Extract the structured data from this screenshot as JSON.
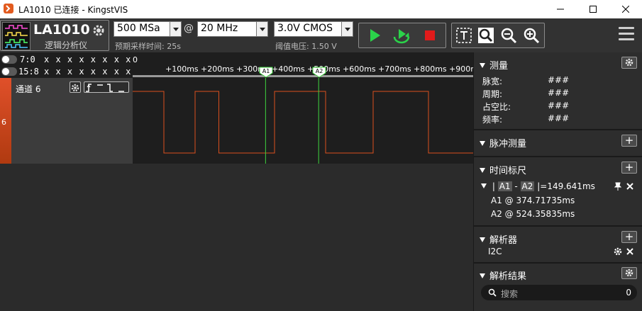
{
  "window": {
    "title": "LA1010 已连接 - KingstVIS"
  },
  "toolbar": {
    "device_name": "LA1010",
    "device_subtitle": "逻辑分析仪",
    "sample_rate": "500 MSa",
    "at_symbol": "@",
    "frequency": "20 MHz",
    "estimated_time": "预期采样时间: 25s",
    "voltage": "3.0V CMOS",
    "threshold": "阈值电压: 1.50 V"
  },
  "bus": {
    "rows": [
      {
        "label": "7:0",
        "value": "x x x x x x x x"
      },
      {
        "label": "15:8",
        "value": "x x x x x x x x"
      }
    ]
  },
  "ruler": {
    "ticks": [
      "0",
      "+100ms",
      "+200ms",
      "+300ms",
      "+400ms",
      "+500ms",
      "+600ms",
      "+700ms",
      "+800ms",
      "+900r"
    ],
    "markers": [
      "A1",
      "A2"
    ]
  },
  "channel": {
    "number": "6",
    "name": "通道 6",
    "signal_color": "#d9501e",
    "cursor_color": "#3fd43f"
  },
  "waveform": {
    "transitions_ms": [
      0,
      88,
      155,
      312,
      456,
      590,
      746
    ],
    "cursor_a1_ms": 374.71735,
    "cursor_a2_ms": 524.35835
  },
  "panel": {
    "measure": {
      "title": "测量",
      "rows": [
        {
          "label": "脉宽:",
          "value": "###"
        },
        {
          "label": "周期:",
          "value": "###"
        },
        {
          "label": "占空比:",
          "value": "###"
        },
        {
          "label": "频率:",
          "value": "###"
        }
      ]
    },
    "pulse": {
      "title": "脉冲测量"
    },
    "cursors": {
      "title": "时间标尺",
      "pair_a": "A1",
      "pair_b": "A2",
      "delta": "=149.641ms",
      "a1": "A1 @ 374.71735ms",
      "a2": "A2 @ 524.35835ms"
    },
    "analyzers": {
      "title": "解析器",
      "items": [
        "I2C"
      ]
    },
    "results": {
      "title": "解析结果",
      "search_placeholder": "搜索",
      "count": "0"
    }
  }
}
